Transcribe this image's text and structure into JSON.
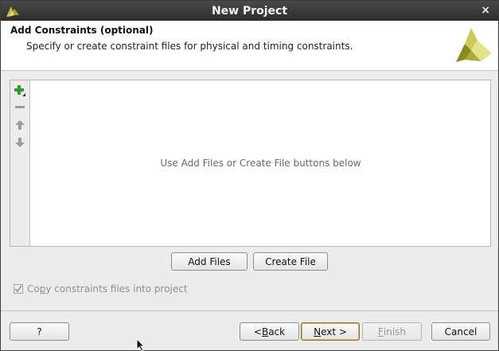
{
  "window": {
    "title": "New Project",
    "close_glyph": "×"
  },
  "header": {
    "title": "Add Constraints (optional)",
    "description": "Specify or create constraint files for physical and timing constraints."
  },
  "toolbar": {
    "add": "add-icon",
    "remove": "remove-icon",
    "up": "arrow-up-icon",
    "down": "arrow-down-icon"
  },
  "files": {
    "placeholder": "Use Add Files or Create File buttons below",
    "items": []
  },
  "actions": {
    "add_files": "Add Files",
    "create_file": "Create File"
  },
  "copy_option": {
    "label_first": "Co",
    "label_access": "p",
    "label_rest": "y constraints files into project",
    "checked": true,
    "enabled": false
  },
  "footer": {
    "help": "?",
    "back_prefix": "< ",
    "back_access": "B",
    "back_rest": "ack",
    "next_access": "N",
    "next_rest": "ext >",
    "finish_access": "F",
    "finish_rest": "inish",
    "cancel": "Cancel"
  },
  "colors": {
    "accent_green": "#2e9e2e",
    "logo_olive": "#8a8a1e",
    "logo_light": "#d8dc6a"
  }
}
